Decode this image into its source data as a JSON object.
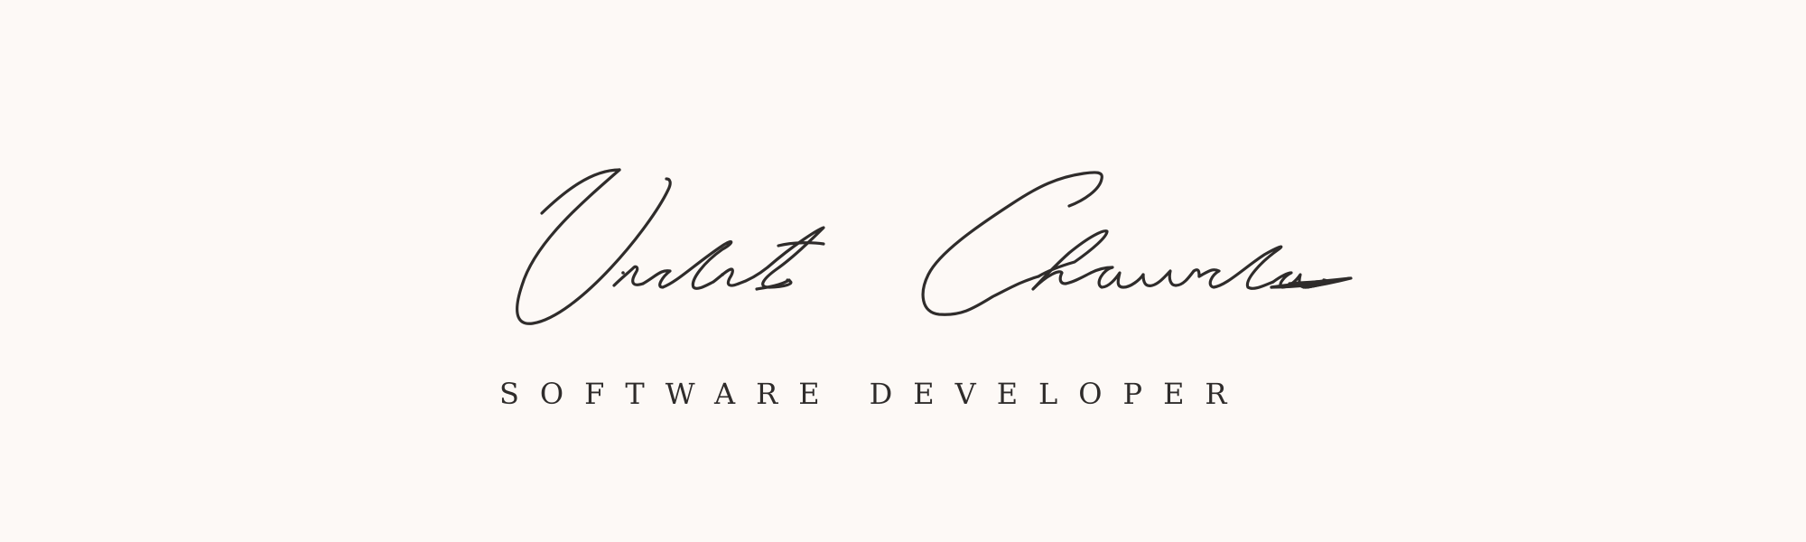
{
  "signature": {
    "text": "Vidit Chawda",
    "ink_color": "#2f2c2b"
  },
  "subtitle": {
    "word1": "SOFTWARE",
    "word2": "DEVELOPER"
  },
  "background_color": "#fdf9f6"
}
